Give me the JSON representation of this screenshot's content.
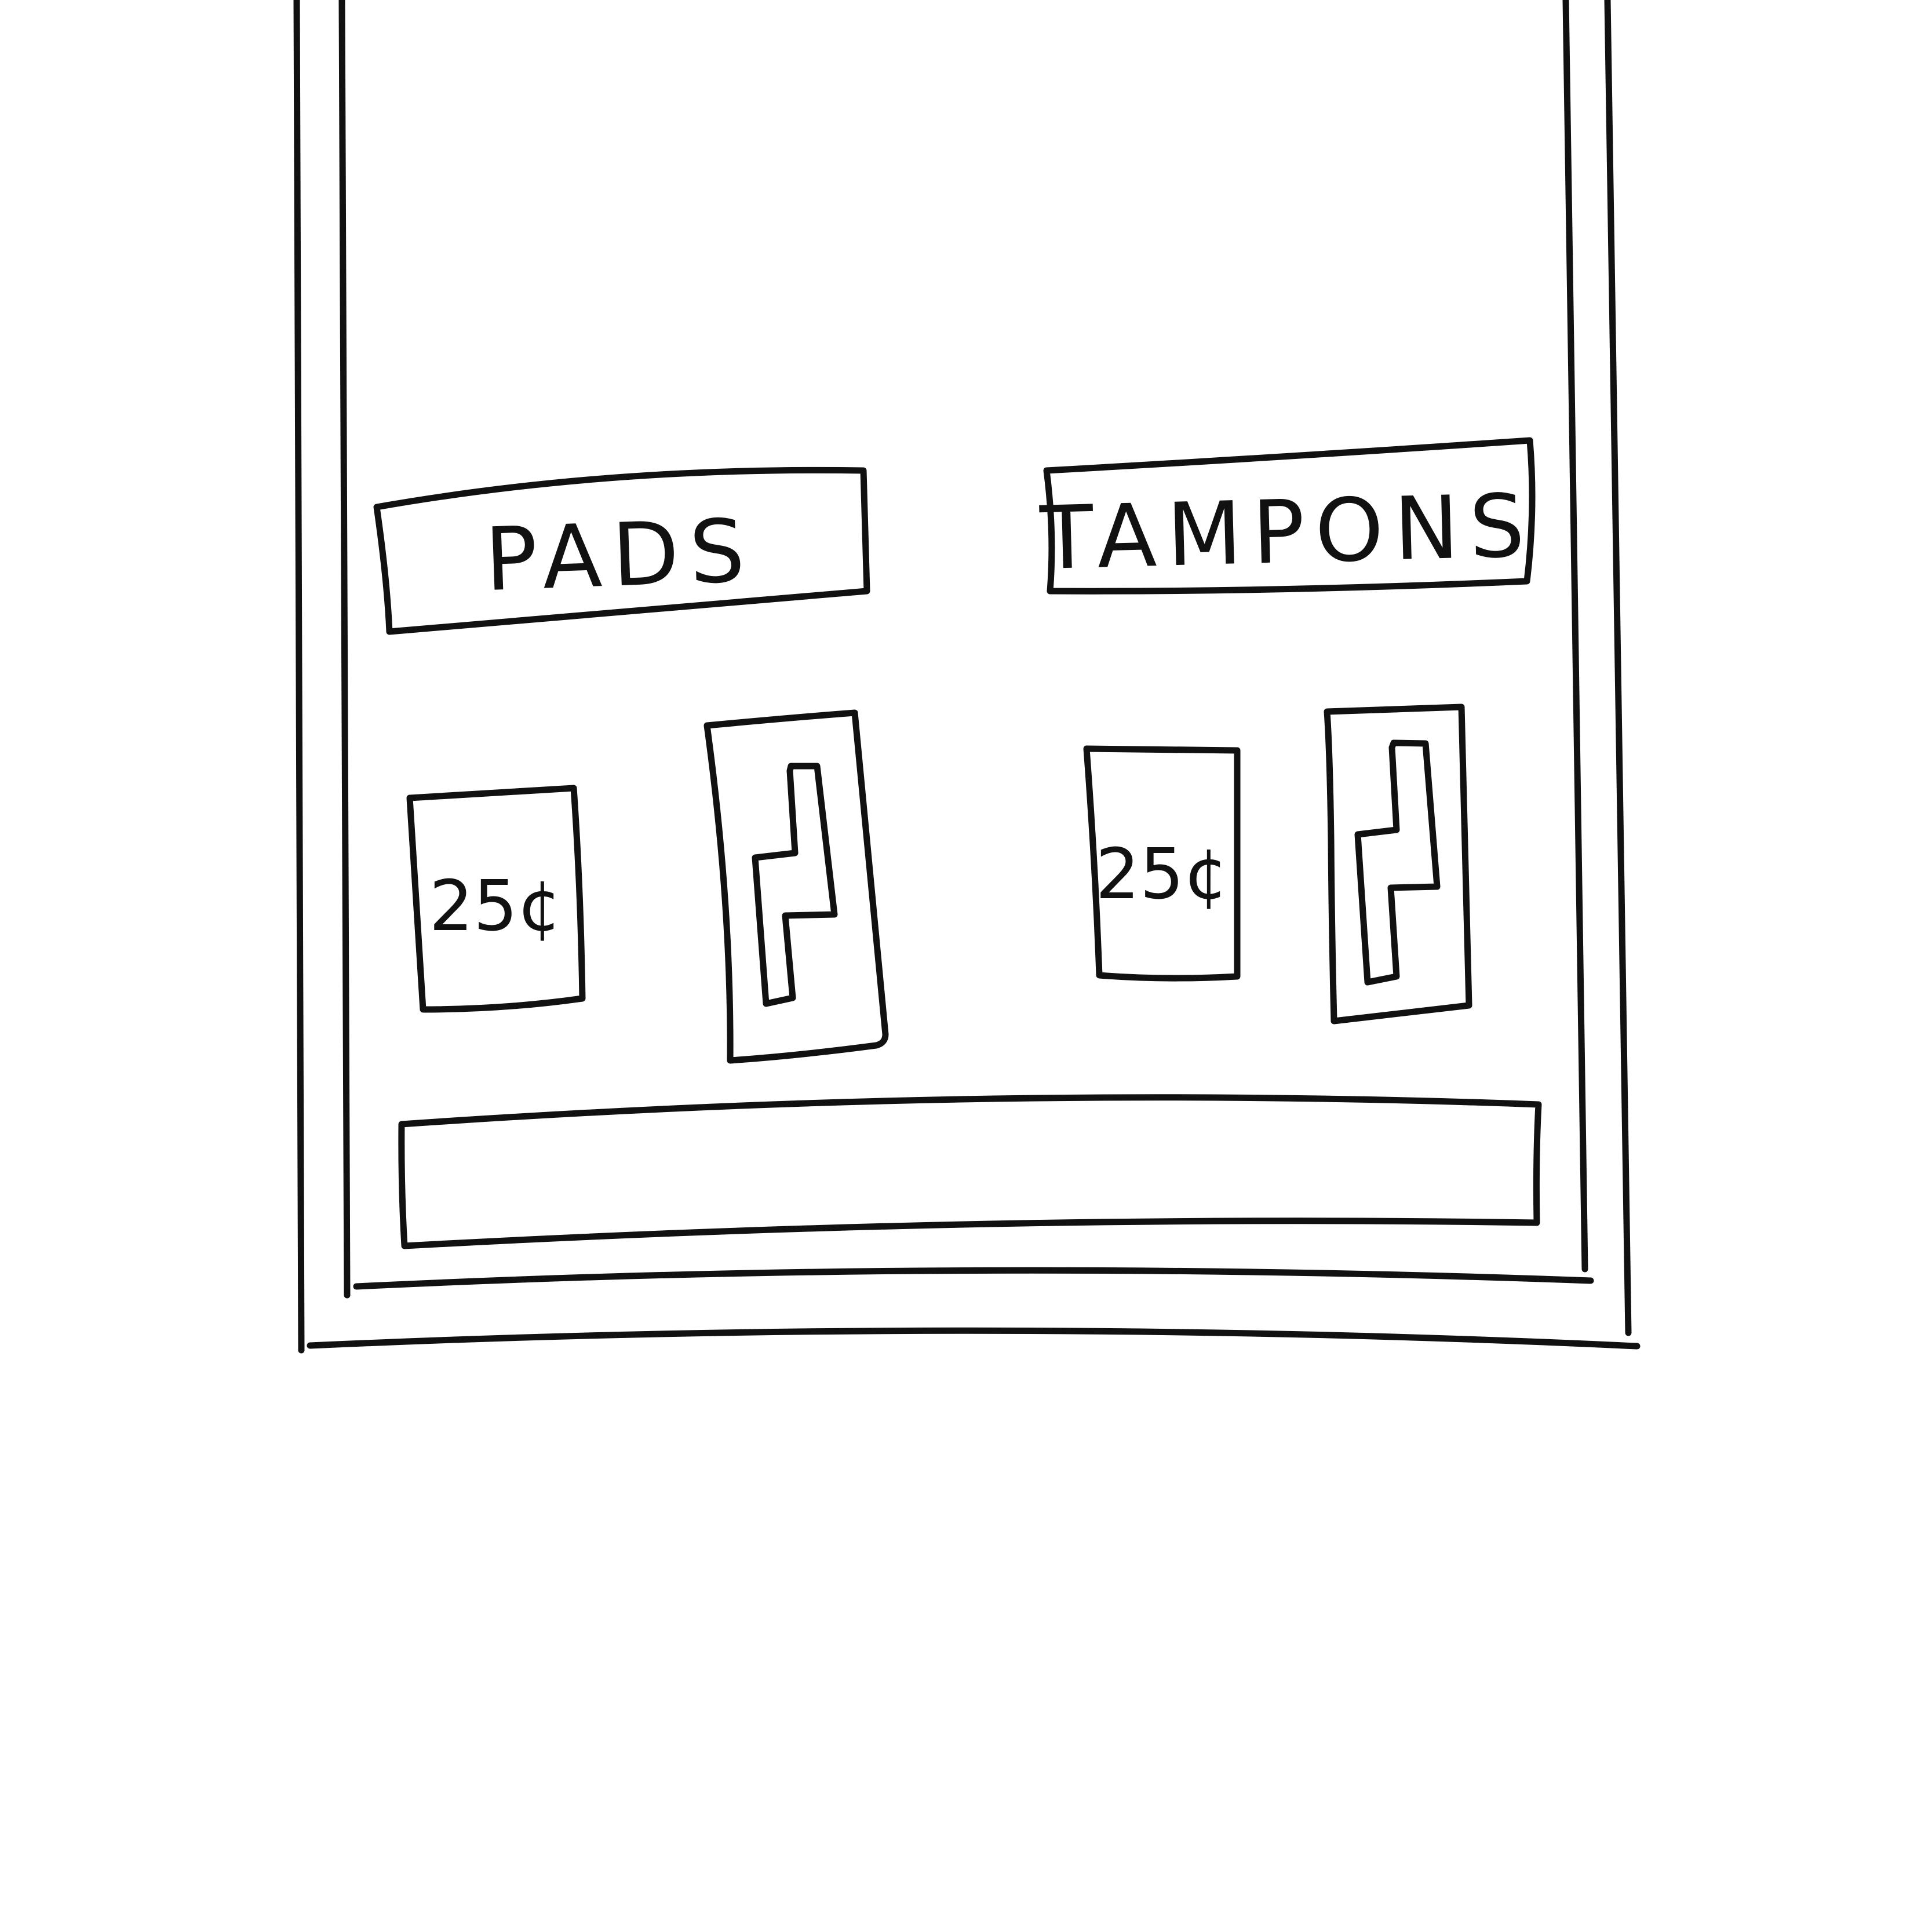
{
  "machine": {
    "pads": {
      "header_label": "PADS",
      "price_label": "25¢"
    },
    "tampons": {
      "header_label": "TAMPONS",
      "price_label": "25¢"
    }
  },
  "colors": {
    "ink": "#111111",
    "background": "#ffffff"
  }
}
